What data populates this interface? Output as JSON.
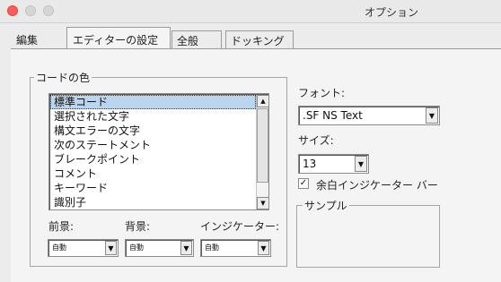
{
  "window": {
    "title": "オプション"
  },
  "tabs": [
    {
      "label": "編集"
    },
    {
      "label": "エディターの設定"
    },
    {
      "label": "全般"
    },
    {
      "label": "ドッキング"
    }
  ],
  "code_colors": {
    "legend": "コードの色",
    "items": [
      {
        "label": "標準コード"
      },
      {
        "label": "選択された文字"
      },
      {
        "label": "構文エラーの文字"
      },
      {
        "label": "次のステートメント"
      },
      {
        "label": "ブレークポイント"
      },
      {
        "label": "コメント"
      },
      {
        "label": "キーワード"
      },
      {
        "label": "識別子"
      }
    ],
    "selected_index": 0,
    "foreground": {
      "label": "前景:",
      "value": "自動"
    },
    "background": {
      "label": "背景:",
      "value": "自動"
    },
    "indicator": {
      "label": "インジケーター:",
      "value": "自動"
    }
  },
  "font": {
    "label": "フォント:",
    "value": ".SF NS Text"
  },
  "size": {
    "label": "サイズ:",
    "value": "13"
  },
  "margin_indicator_bar": {
    "label": "余白インジケーター バー",
    "checked": true,
    "mark": "✓"
  },
  "sample": {
    "legend": "サンプル"
  },
  "icons": {
    "scroll_up": "▲",
    "scroll_down": "▼",
    "dropdown": "▼"
  }
}
